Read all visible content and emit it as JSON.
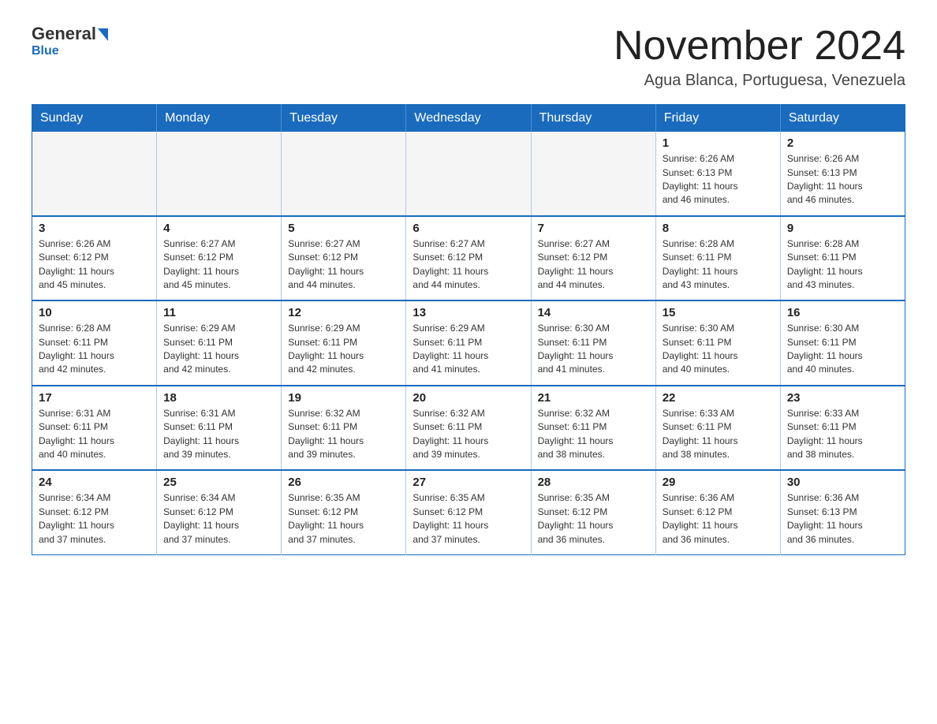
{
  "header": {
    "logo_general": "General",
    "logo_blue": "Blue",
    "month_title": "November 2024",
    "location": "Agua Blanca, Portuguesa, Venezuela"
  },
  "days_of_week": [
    "Sunday",
    "Monday",
    "Tuesday",
    "Wednesday",
    "Thursday",
    "Friday",
    "Saturday"
  ],
  "weeks": [
    [
      {
        "day": "",
        "info": ""
      },
      {
        "day": "",
        "info": ""
      },
      {
        "day": "",
        "info": ""
      },
      {
        "day": "",
        "info": ""
      },
      {
        "day": "",
        "info": ""
      },
      {
        "day": "1",
        "info": "Sunrise: 6:26 AM\nSunset: 6:13 PM\nDaylight: 11 hours\nand 46 minutes."
      },
      {
        "day": "2",
        "info": "Sunrise: 6:26 AM\nSunset: 6:13 PM\nDaylight: 11 hours\nand 46 minutes."
      }
    ],
    [
      {
        "day": "3",
        "info": "Sunrise: 6:26 AM\nSunset: 6:12 PM\nDaylight: 11 hours\nand 45 minutes."
      },
      {
        "day": "4",
        "info": "Sunrise: 6:27 AM\nSunset: 6:12 PM\nDaylight: 11 hours\nand 45 minutes."
      },
      {
        "day": "5",
        "info": "Sunrise: 6:27 AM\nSunset: 6:12 PM\nDaylight: 11 hours\nand 44 minutes."
      },
      {
        "day": "6",
        "info": "Sunrise: 6:27 AM\nSunset: 6:12 PM\nDaylight: 11 hours\nand 44 minutes."
      },
      {
        "day": "7",
        "info": "Sunrise: 6:27 AM\nSunset: 6:12 PM\nDaylight: 11 hours\nand 44 minutes."
      },
      {
        "day": "8",
        "info": "Sunrise: 6:28 AM\nSunset: 6:11 PM\nDaylight: 11 hours\nand 43 minutes."
      },
      {
        "day": "9",
        "info": "Sunrise: 6:28 AM\nSunset: 6:11 PM\nDaylight: 11 hours\nand 43 minutes."
      }
    ],
    [
      {
        "day": "10",
        "info": "Sunrise: 6:28 AM\nSunset: 6:11 PM\nDaylight: 11 hours\nand 42 minutes."
      },
      {
        "day": "11",
        "info": "Sunrise: 6:29 AM\nSunset: 6:11 PM\nDaylight: 11 hours\nand 42 minutes."
      },
      {
        "day": "12",
        "info": "Sunrise: 6:29 AM\nSunset: 6:11 PM\nDaylight: 11 hours\nand 42 minutes."
      },
      {
        "day": "13",
        "info": "Sunrise: 6:29 AM\nSunset: 6:11 PM\nDaylight: 11 hours\nand 41 minutes."
      },
      {
        "day": "14",
        "info": "Sunrise: 6:30 AM\nSunset: 6:11 PM\nDaylight: 11 hours\nand 41 minutes."
      },
      {
        "day": "15",
        "info": "Sunrise: 6:30 AM\nSunset: 6:11 PM\nDaylight: 11 hours\nand 40 minutes."
      },
      {
        "day": "16",
        "info": "Sunrise: 6:30 AM\nSunset: 6:11 PM\nDaylight: 11 hours\nand 40 minutes."
      }
    ],
    [
      {
        "day": "17",
        "info": "Sunrise: 6:31 AM\nSunset: 6:11 PM\nDaylight: 11 hours\nand 40 minutes."
      },
      {
        "day": "18",
        "info": "Sunrise: 6:31 AM\nSunset: 6:11 PM\nDaylight: 11 hours\nand 39 minutes."
      },
      {
        "day": "19",
        "info": "Sunrise: 6:32 AM\nSunset: 6:11 PM\nDaylight: 11 hours\nand 39 minutes."
      },
      {
        "day": "20",
        "info": "Sunrise: 6:32 AM\nSunset: 6:11 PM\nDaylight: 11 hours\nand 39 minutes."
      },
      {
        "day": "21",
        "info": "Sunrise: 6:32 AM\nSunset: 6:11 PM\nDaylight: 11 hours\nand 38 minutes."
      },
      {
        "day": "22",
        "info": "Sunrise: 6:33 AM\nSunset: 6:11 PM\nDaylight: 11 hours\nand 38 minutes."
      },
      {
        "day": "23",
        "info": "Sunrise: 6:33 AM\nSunset: 6:11 PM\nDaylight: 11 hours\nand 38 minutes."
      }
    ],
    [
      {
        "day": "24",
        "info": "Sunrise: 6:34 AM\nSunset: 6:12 PM\nDaylight: 11 hours\nand 37 minutes."
      },
      {
        "day": "25",
        "info": "Sunrise: 6:34 AM\nSunset: 6:12 PM\nDaylight: 11 hours\nand 37 minutes."
      },
      {
        "day": "26",
        "info": "Sunrise: 6:35 AM\nSunset: 6:12 PM\nDaylight: 11 hours\nand 37 minutes."
      },
      {
        "day": "27",
        "info": "Sunrise: 6:35 AM\nSunset: 6:12 PM\nDaylight: 11 hours\nand 37 minutes."
      },
      {
        "day": "28",
        "info": "Sunrise: 6:35 AM\nSunset: 6:12 PM\nDaylight: 11 hours\nand 36 minutes."
      },
      {
        "day": "29",
        "info": "Sunrise: 6:36 AM\nSunset: 6:12 PM\nDaylight: 11 hours\nand 36 minutes."
      },
      {
        "day": "30",
        "info": "Sunrise: 6:36 AM\nSunset: 6:13 PM\nDaylight: 11 hours\nand 36 minutes."
      }
    ]
  ]
}
